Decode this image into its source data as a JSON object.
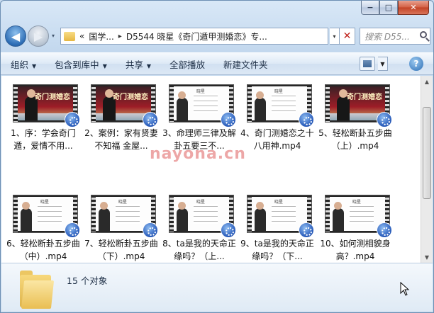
{
  "window": {
    "caption": {
      "minimize": "−",
      "maximize": "□",
      "close": "✕"
    }
  },
  "nav": {
    "back": "◀",
    "forward": "▶",
    "dropdown": "▾"
  },
  "address": {
    "prefix": "«",
    "crumbs": [
      "国学...",
      "D5544 晓星《奇门遁甲测婚恋》专..."
    ],
    "separator": "▸"
  },
  "search": {
    "placeholder": "搜索 D55..."
  },
  "toolbar": {
    "items": [
      {
        "label": "组织",
        "has_dropdown": true
      },
      {
        "label": "包含到库中",
        "has_dropdown": true
      },
      {
        "label": "共享",
        "has_dropdown": true
      },
      {
        "label": "全部播放",
        "has_dropdown": false
      },
      {
        "label": "新建文件夹",
        "has_dropdown": false
      }
    ],
    "dropdown_arrow": "▼",
    "help": "?"
  },
  "files": [
    {
      "label": "1、序：学会奇门遁，爱情不用...",
      "thumb": "red"
    },
    {
      "label": "2、案例：家有贤妻不知福 金屋...",
      "thumb": "red"
    },
    {
      "label": "3、命理师三律及解卦五要三不...",
      "thumb": "white"
    },
    {
      "label": "4、奇门测婚恋之十八用神.mp4",
      "thumb": "white"
    },
    {
      "label": "5、轻松断卦五步曲（上）.mp4",
      "thumb": "red"
    },
    {
      "label": "6、轻松断卦五步曲（中）.mp4",
      "thumb": "white"
    },
    {
      "label": "7、轻松断卦五步曲（下）.mp4",
      "thumb": "white"
    },
    {
      "label": "8、ta是我的天命正缘吗？（上...",
      "thumb": "white"
    },
    {
      "label": "9、ta是我的天命正缘吗？（下...",
      "thumb": "white"
    },
    {
      "label": "10、如何测相貌身高？.mp4",
      "thumb": "white"
    }
  ],
  "thumb_text": {
    "red_title": "奇门测婚恋",
    "white_title": "晓星"
  },
  "status": {
    "count": "15 个对象"
  },
  "watermark": "nayona.cn",
  "colors": {
    "accent": "#2d6db5",
    "close": "#c24225"
  }
}
